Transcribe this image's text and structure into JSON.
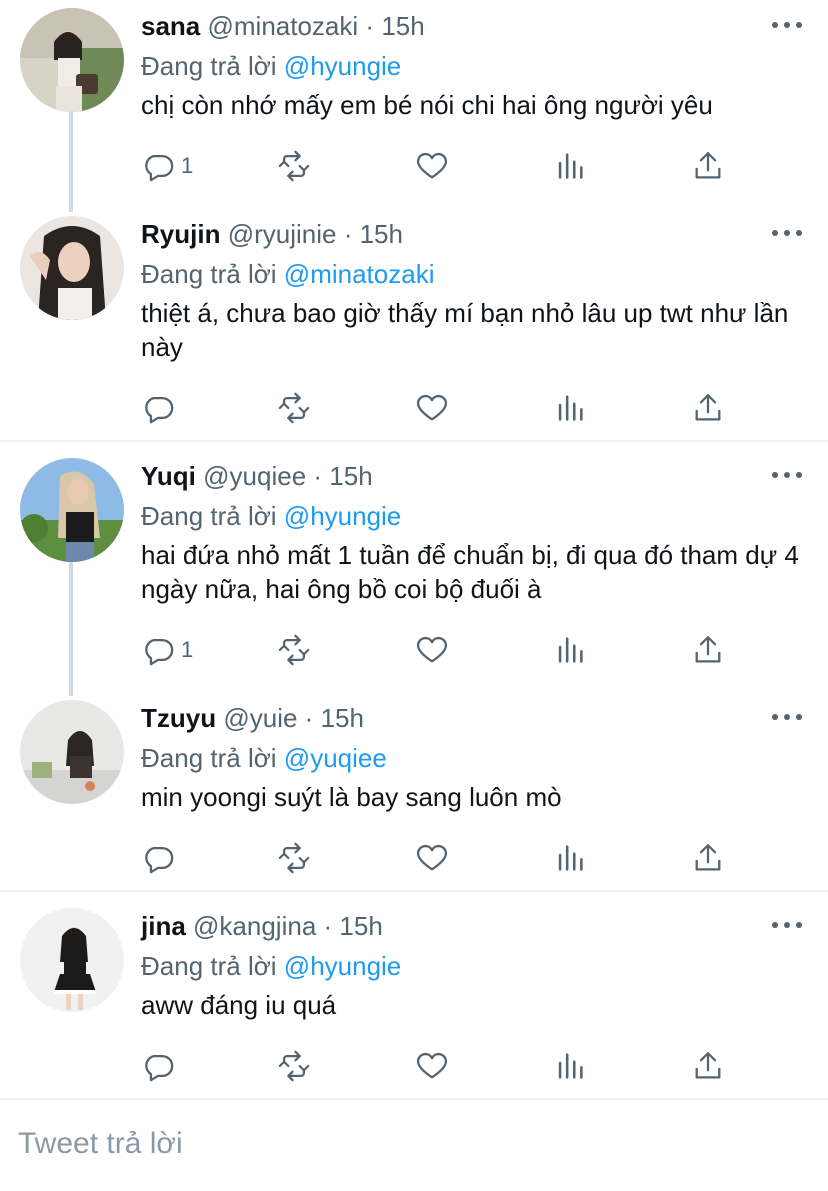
{
  "replying_label": "Đang trả lời",
  "tweets": [
    {
      "name": "sana",
      "handle": "@minatozaki",
      "time": "15h",
      "reply_to": "@hyungie",
      "text": "chị còn nhớ mấy em bé nói chi hai ông người yêu",
      "reply_count": "1"
    },
    {
      "name": "Ryujin",
      "handle": "@ryujinie",
      "time": "15h",
      "reply_to": "@minatozaki",
      "text": "thiệt á, chưa bao giờ thấy mí bạn nhỏ lâu up twt như lần này",
      "reply_count": ""
    },
    {
      "name": "Yuqi",
      "handle": "@yuqiee",
      "time": "15h",
      "reply_to": "@hyungie",
      "text": "hai đứa nhỏ mất 1 tuần để chuẩn bị, đi qua đó tham dự 4 ngày nữa, hai ông bồ coi bộ đuối à",
      "reply_count": "1"
    },
    {
      "name": "Tzuyu",
      "handle": "@yuie",
      "time": "15h",
      "reply_to": "@yuqiee",
      "text": "min yoongi suýt là bay sang luôn mò",
      "reply_count": ""
    },
    {
      "name": "jina",
      "handle": "@kangjina",
      "time": "15h",
      "reply_to": "@hyungie",
      "text": "aww đáng iu quá",
      "reply_count": ""
    }
  ],
  "composer": {
    "placeholder": "Tweet trả lời"
  },
  "icons": {
    "reply": "reply-icon",
    "retweet": "retweet-icon",
    "like": "heart-icon",
    "analytics": "analytics-icon",
    "share": "share-icon",
    "more": "more-icon"
  },
  "colors": {
    "link": "#1d9bf0",
    "muted": "#536471",
    "thread_line": "#cfd9de"
  }
}
